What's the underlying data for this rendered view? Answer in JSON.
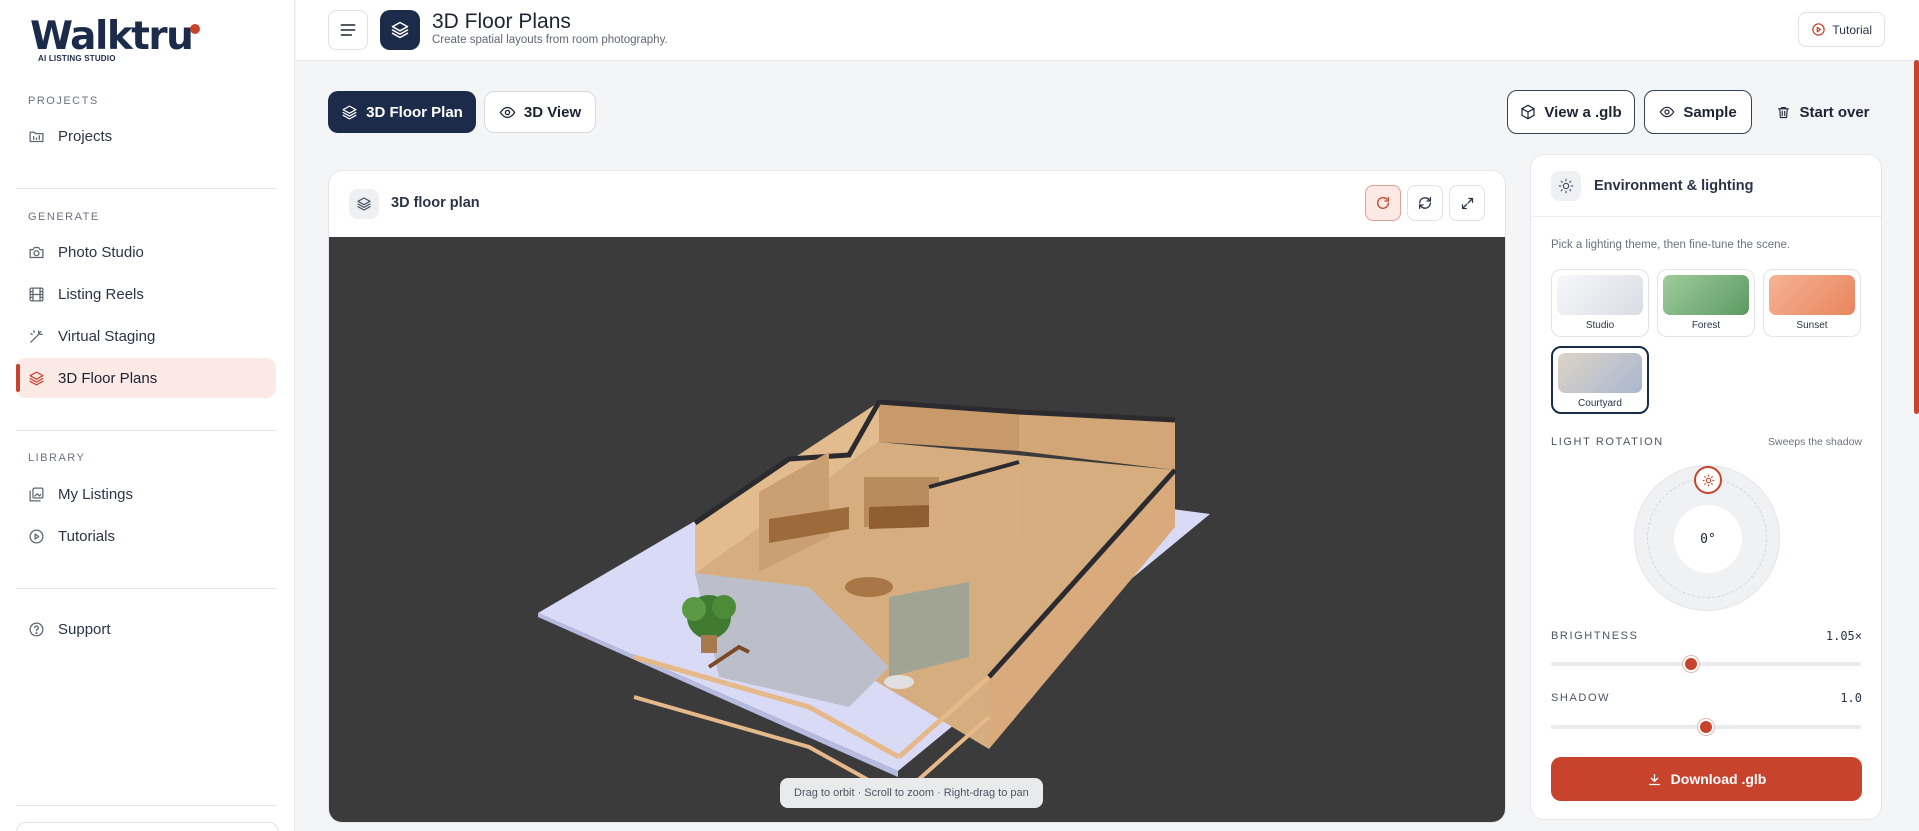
{
  "brand": {
    "name": "Walktru",
    "tagline": "AI LISTING STUDIO"
  },
  "sidebar": {
    "sections": [
      {
        "label": "PROJECTS",
        "items": [
          {
            "label": "Projects",
            "icon": "folder-icon"
          }
        ]
      },
      {
        "label": "GENERATE",
        "items": [
          {
            "label": "Photo Studio",
            "icon": "camera-icon"
          },
          {
            "label": "Listing Reels",
            "icon": "film-icon"
          },
          {
            "label": "Virtual Staging",
            "icon": "wand-icon"
          },
          {
            "label": "3D Floor Plans",
            "icon": "layers-icon",
            "active": true
          }
        ]
      },
      {
        "label": "LIBRARY",
        "items": [
          {
            "label": "My Listings",
            "icon": "gallery-icon"
          },
          {
            "label": "Tutorials",
            "icon": "play-circle-icon"
          }
        ]
      }
    ],
    "support": {
      "label": "Support",
      "icon": "help-icon"
    }
  },
  "header": {
    "title": "3D Floor Plans",
    "subtitle": "Create spatial layouts from room photography.",
    "tutorial_label": "Tutorial"
  },
  "toolbar": {
    "tabs": [
      {
        "label": "3D Floor Plan",
        "active": true
      },
      {
        "label": "3D View",
        "active": false
      }
    ],
    "view_glb_label": "View a .glb",
    "sample_label": "Sample",
    "start_over_label": "Start over"
  },
  "viewer": {
    "title": "3D floor plan",
    "hint": "Drag to orbit · Scroll to zoom · Right-drag to pan"
  },
  "panel": {
    "title": "Environment & lighting",
    "description": "Pick a lighting theme, then fine-tune the scene.",
    "themes": [
      {
        "label": "Studio",
        "gradient": [
          "#f7f8fa",
          "#d9dce3"
        ],
        "selected": false
      },
      {
        "label": "Forest",
        "gradient": [
          "#9fcc9b",
          "#5c9a62"
        ],
        "selected": false
      },
      {
        "label": "Sunset",
        "gradient": [
          "#f6b295",
          "#e8855c"
        ],
        "selected": false
      },
      {
        "label": "Courtyard",
        "gradient": [
          "#ddd4c6",
          "#a9b7d0"
        ],
        "selected": true
      }
    ],
    "light_rotation": {
      "label": "LIGHT ROTATION",
      "hint": "Sweeps the shadow",
      "value": "0°"
    },
    "brightness": {
      "label": "BRIGHTNESS",
      "display": "1.05×",
      "fraction": 0.45
    },
    "shadow": {
      "label": "SHADOW",
      "display": "1.0",
      "fraction": 0.5
    },
    "download_label": "Download .glb"
  },
  "colors": {
    "accent": "#c8432c",
    "navy": "#1d2b4a",
    "canvas": "#3b3b3c"
  }
}
